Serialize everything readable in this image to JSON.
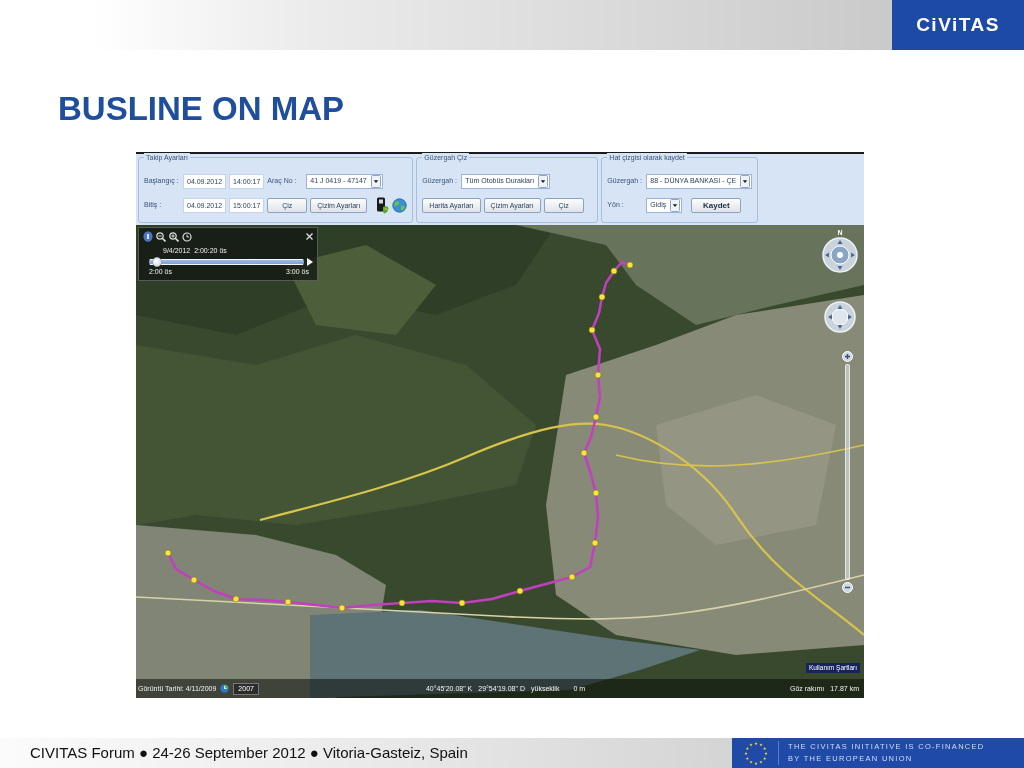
{
  "header": {
    "logo": "CiViTAS"
  },
  "title": "BUSLINE ON MAP",
  "app": {
    "toolbar": [
      {
        "legend": "Takip Ayarları",
        "rows": [
          [
            {
              "kind": "label",
              "text": "Başlangıç :"
            },
            {
              "kind": "field",
              "value": "04.09.2012"
            },
            {
              "kind": "field",
              "value": "14:00:17"
            },
            {
              "kind": "label",
              "text": "Araç No :"
            },
            {
              "kind": "dropdown",
              "value": "41 J 0419 - 47147"
            }
          ],
          [
            {
              "kind": "label",
              "text": "Bitiş :"
            },
            {
              "kind": "field",
              "value": "04.09.2012"
            },
            {
              "kind": "field",
              "value": "15:00:17"
            },
            {
              "kind": "button",
              "text": "Çiz",
              "default": false
            },
            {
              "kind": "button",
              "text": "Çizim Ayarları",
              "default": false
            },
            {
              "kind": "device"
            },
            {
              "kind": "globe"
            }
          ]
        ]
      },
      {
        "legend": "Güzergah Çiz",
        "rows": [
          [
            {
              "kind": "label",
              "text": "Güzergah :"
            },
            {
              "kind": "dropdown",
              "value": "Tüm Otobüs Durakları"
            }
          ],
          [
            {
              "kind": "button",
              "text": "Harita Ayarları",
              "default": false
            },
            {
              "kind": "button",
              "text": "Çizim Ayarları",
              "default": false
            },
            {
              "kind": "button",
              "text": "Çiz",
              "default": false
            }
          ]
        ]
      },
      {
        "legend": "Hat çizgisi olarak kaydet",
        "rows": [
          [
            {
              "kind": "label",
              "text": "Güzergah :"
            },
            {
              "kind": "dropdown",
              "value": "88 - DÜNYA BANKASI - ÇE"
            }
          ],
          [
            {
              "kind": "label",
              "text": "Yön :"
            },
            {
              "kind": "dropdown",
              "value": "Gidiş"
            },
            {
              "kind": "button",
              "text": "Kaydet",
              "default": true
            }
          ]
        ]
      }
    ],
    "map": {
      "time_slider": {
        "date": "9/4/2012  2:00:20 ös",
        "start": "2:00 ös",
        "end": "3:00 ös",
        "level": 0.02
      },
      "compass": {
        "north": "N"
      },
      "terms": "Kullanım Şartları",
      "status_bar": {
        "imagery_date": "Görüntü Tarihi: 4/11/2009",
        "history_year": "2007",
        "latitude": "40°45'20.08\" K",
        "longitude": "29°54'19.08\" D",
        "elevation_label": "yükseklik",
        "elevation": "0 m",
        "eye_altitude_label": "Göz rakımı",
        "eye_altitude": "17.87 km"
      }
    }
  },
  "footer": {
    "text": "CIVITAS Forum ● 24-26 September 2012 ● Vitoria-Gasteiz, Spain",
    "notice": [
      "THE CIVITAS INITIATIVE IS CO-FINANCED",
      "BY THE EUROPEAN UNION"
    ]
  }
}
